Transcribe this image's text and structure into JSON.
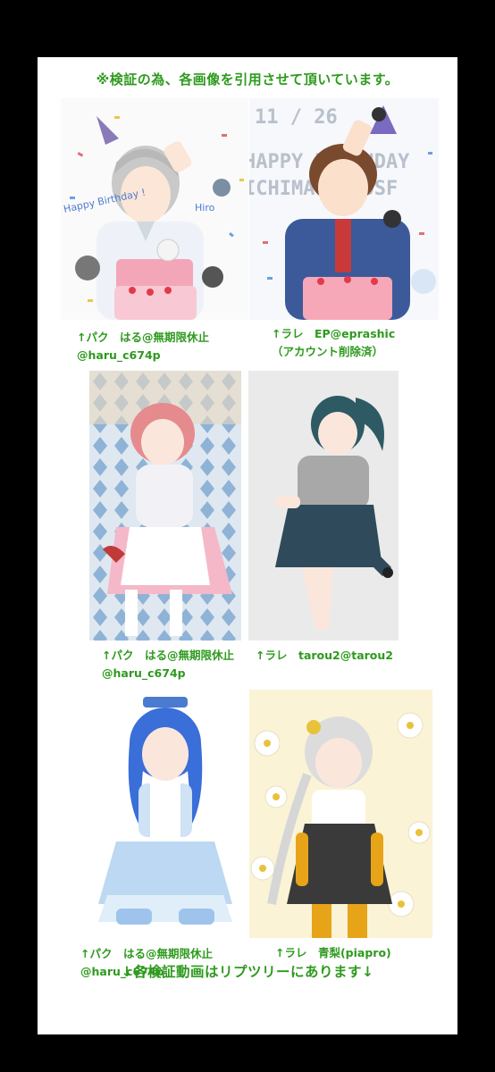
{
  "header": {
    "notice": "※検証の為、各画像を引用させて頂いています。"
  },
  "images": [
    {
      "side": "パク",
      "overlay_text": [
        "Happy Birthday !",
        "Hiro"
      ]
    },
    {
      "side": "ラレ",
      "overlay_text": [
        "11 / 26",
        "HAPPY BIRTHDAY",
        "ICHIMATSU OSF"
      ]
    },
    {
      "side": "パク"
    },
    {
      "side": "ラレ"
    },
    {
      "side": "パク"
    },
    {
      "side": "ラレ"
    }
  ],
  "captions": [
    {
      "line1": "↑パク　はる@無期限休止",
      "line2": "@haru_c674p"
    },
    {
      "line1": "↑ラレ　EP@eprashic",
      "line2": "（アカウント削除済）"
    },
    {
      "line1": "↑パク　はる@無期限休止",
      "line2": "@haru_c674p"
    },
    {
      "line1": "↑ラレ　tarou2@tarou2",
      "line2": ""
    },
    {
      "line1": "↑パク　はる@無期限休止",
      "line2": "@haru_c674p"
    },
    {
      "line1": "↑ラレ　青梨(piapro)",
      "line2": ""
    }
  ],
  "footer": {
    "text": "↓各検証動画はリプツリーにあります↓"
  },
  "colors": {
    "accent_green": "#2e9a1e",
    "background": "#000000",
    "card": "#ffffff"
  }
}
